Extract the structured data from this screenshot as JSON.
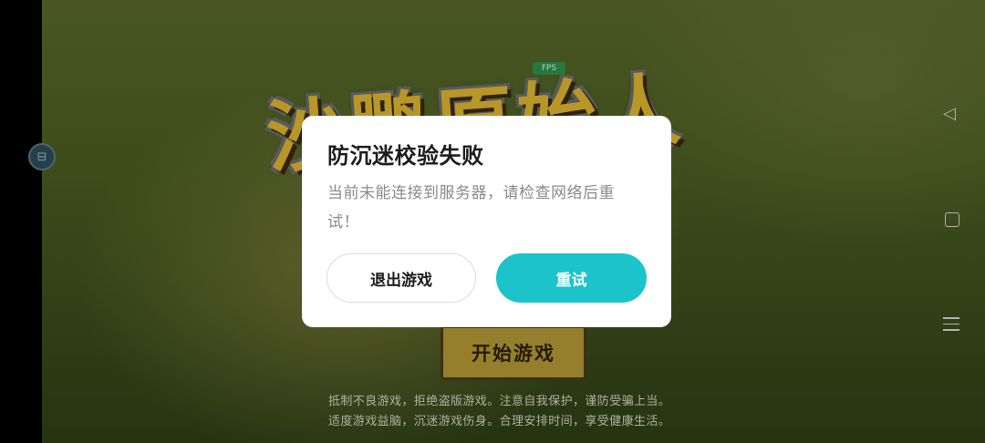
{
  "game": {
    "title_logo": "沙鹏原始人",
    "tag": "FPS",
    "start_button": "开始游戏",
    "notice_lines": [
      "抵制不良游戏，拒绝盗版游戏。注意自我保护，谨防受骗上当。",
      "适度游戏益脑，沉迷游戏伤身。合理安排时间，享受健康生活。"
    ]
  },
  "dialog": {
    "title": "防沉迷校验失败",
    "message": "当前未能连接到服务器，请检查网络后重试！",
    "exit_label": "退出游戏",
    "retry_label": "重试",
    "retry_color": "#1cc3cb"
  },
  "nav": {
    "back_icon": "triangle-back-icon",
    "home_icon": "square-home-icon",
    "menu_icon": "menu-lines-icon"
  }
}
